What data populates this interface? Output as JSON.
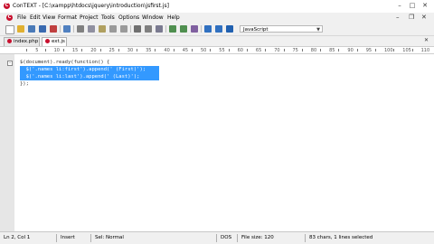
{
  "window": {
    "title": "ConTEXT - [C:\\xampp\\htdocs\\jquery\\introduction\\jsfirst.js]",
    "app_icon": "C"
  },
  "menu": {
    "items": [
      "File",
      "Edit",
      "View",
      "Format",
      "Project",
      "Tools",
      "Options",
      "Window",
      "Help"
    ]
  },
  "toolbar": {
    "language": "JavaScript"
  },
  "tabs": [
    {
      "label": "index.php",
      "active": false
    },
    {
      "label": "ext.js",
      "active": true
    }
  ],
  "ruler": {
    "marks": [
      "5",
      "10",
      "15",
      "20",
      "25",
      "30",
      "35",
      "40",
      "45",
      "50",
      "55",
      "60",
      "65",
      "70",
      "75",
      "80",
      "85",
      "90",
      "95",
      "100",
      "105",
      "110"
    ]
  },
  "editor": {
    "lines": [
      {
        "text": "$(document).ready(function() {",
        "selected": false
      },
      {
        "text": "  $('.names li:first').append(' (First)');",
        "selected": true
      },
      {
        "text": "  $('.names li:last').append(' (Last)');",
        "selected": true
      },
      {
        "text": "});",
        "selected": false
      }
    ]
  },
  "status": {
    "position": "Ln 2, Col 1",
    "mode": "Insert",
    "selection_mode": "Sel: Normal",
    "line_endings": "DOS",
    "file_size": "File size: 120",
    "selection_info": "83 chars, 1 lines selected"
  },
  "colors": {
    "selection": "#3399ff",
    "app_icon": "#c8102e"
  }
}
